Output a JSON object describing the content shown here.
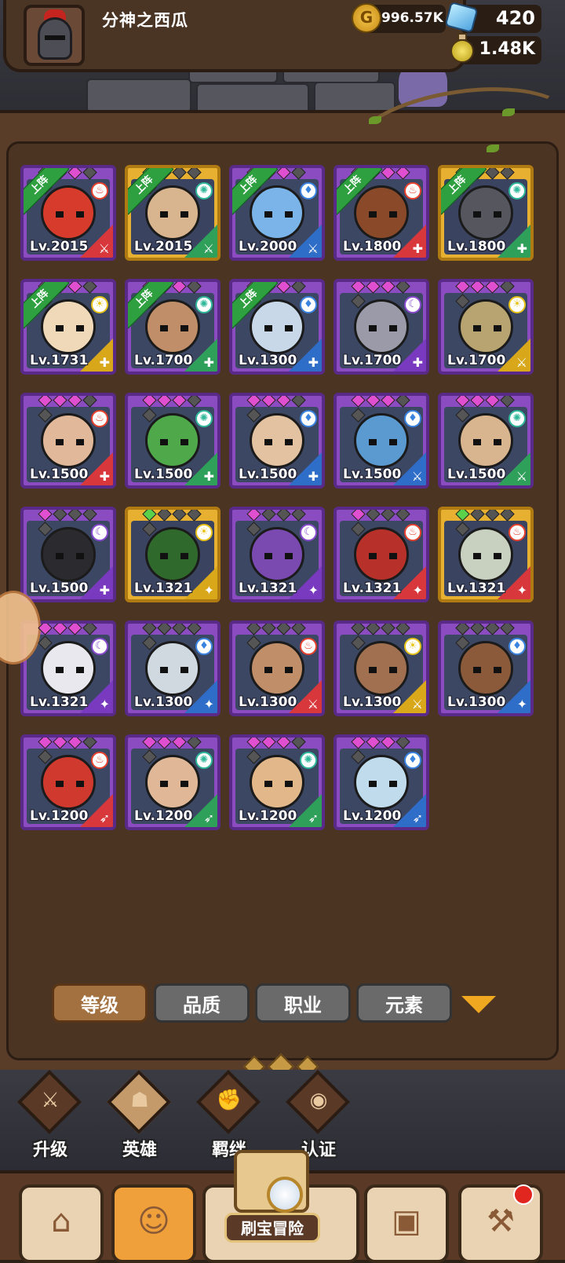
{
  "player": {
    "name": "分神之西瓜"
  },
  "resources": {
    "gold": "996.57K",
    "gems": "420",
    "potion": "1.48K"
  },
  "heroes": [
    {
      "level": "Lv.2015",
      "frame": "purple",
      "deployed": true,
      "element": "fire",
      "element_color": "#e8422e",
      "class_color": "#d8383c",
      "class_glyph": "⚔",
      "skin": "#d63b2c",
      "stars_on": 3,
      "star_color": "g"
    },
    {
      "level": "Lv.2015",
      "frame": "gold",
      "deployed": true,
      "element": "wind",
      "element_color": "#2fb89a",
      "class_color": "#2fa05a",
      "class_glyph": "⚔",
      "skin": "#d9b58f",
      "stars_on": 1,
      "star_color": "g"
    },
    {
      "level": "Lv.2000",
      "frame": "purple",
      "deployed": true,
      "element": "water",
      "element_color": "#3a84e0",
      "class_color": "#2f6ec8",
      "class_glyph": "⚔",
      "skin": "#7ab4e8",
      "stars_on": 3,
      "star_color": "on"
    },
    {
      "level": "Lv.1800",
      "frame": "purple",
      "deployed": true,
      "element": "fire",
      "element_color": "#e8422e",
      "class_color": "#d8383c",
      "class_glyph": "✚",
      "skin": "#8a4a2a",
      "stars_on": 5,
      "star_color": "on"
    },
    {
      "level": "Lv.1800",
      "frame": "gold",
      "deployed": true,
      "element": "wind",
      "element_color": "#2fb89a",
      "class_color": "#2fa05a",
      "class_glyph": "✚",
      "skin": "#55565e",
      "stars_on": 1,
      "star_color": "g"
    },
    {
      "level": "Lv.1731",
      "frame": "purple",
      "deployed": true,
      "element": "light",
      "element_color": "#e8c41a",
      "class_color": "#d8a81a",
      "class_glyph": "✚",
      "skin": "#f0d9b8",
      "stars_on": 3,
      "star_color": "on"
    },
    {
      "level": "Lv.1700",
      "frame": "purple",
      "deployed": true,
      "element": "wind",
      "element_color": "#2fb89a",
      "class_color": "#2fa05a",
      "class_glyph": "✚",
      "skin": "#c08e68",
      "stars_on": 3,
      "star_color": "on"
    },
    {
      "level": "Lv.1300",
      "frame": "purple",
      "deployed": true,
      "element": "water",
      "element_color": "#3a84e0",
      "class_color": "#2f6ec8",
      "class_glyph": "✚",
      "skin": "#c8d8e8",
      "stars_on": 3,
      "star_color": "on"
    },
    {
      "level": "Lv.1700",
      "frame": "purple",
      "deployed": false,
      "element": "dark",
      "element_color": "#8a4ad0",
      "class_color": "#7a3ac0",
      "class_glyph": "✚",
      "skin": "#9a9aa8",
      "stars_on": 3,
      "star_color": "on"
    },
    {
      "level": "Lv.1700",
      "frame": "purple",
      "deployed": false,
      "element": "light",
      "element_color": "#e8c41a",
      "class_color": "#d8a81a",
      "class_glyph": "⚔",
      "skin": "#b8a470",
      "stars_on": 3,
      "star_color": "on"
    },
    {
      "level": "Lv.1500",
      "frame": "purple",
      "deployed": false,
      "element": "fire",
      "element_color": "#e8422e",
      "class_color": "#d8383c",
      "class_glyph": "✚",
      "skin": "#e2b89a",
      "stars_on": 3,
      "star_color": "on"
    },
    {
      "level": "Lv.1500",
      "frame": "purple",
      "deployed": false,
      "element": "wind",
      "element_color": "#2fb89a",
      "class_color": "#2fa05a",
      "class_glyph": "✚",
      "skin": "#4fa84a",
      "stars_on": 3,
      "star_color": "on"
    },
    {
      "level": "Lv.1500",
      "frame": "purple",
      "deployed": false,
      "element": "water",
      "element_color": "#3a84e0",
      "class_color": "#2f6ec8",
      "class_glyph": "✚",
      "skin": "#e2c2a0",
      "stars_on": 3,
      "star_color": "on"
    },
    {
      "level": "Lv.1500",
      "frame": "purple",
      "deployed": false,
      "element": "water",
      "element_color": "#3a84e0",
      "class_color": "#2f6ec8",
      "class_glyph": "⚔",
      "skin": "#5a9ad0",
      "stars_on": 3,
      "star_color": "on"
    },
    {
      "level": "Lv.1500",
      "frame": "purple",
      "deployed": false,
      "element": "wind",
      "element_color": "#2fb89a",
      "class_color": "#2fa05a",
      "class_glyph": "⚔",
      "skin": "#d9b58f",
      "stars_on": 3,
      "star_color": "on"
    },
    {
      "level": "Lv.1500",
      "frame": "purple",
      "deployed": false,
      "element": "dark",
      "element_color": "#8a4ad0",
      "class_color": "#7a3ac0",
      "class_glyph": "✚",
      "skin": "#2b2b2f",
      "stars_on": 1,
      "star_color": "on"
    },
    {
      "level": "Lv.1321",
      "frame": "gold",
      "deployed": false,
      "element": "light",
      "element_color": "#e8c41a",
      "class_color": "#d8a81a",
      "class_glyph": "✦",
      "skin": "#2f6a2c",
      "stars_on": 1,
      "star_color": "g"
    },
    {
      "level": "Lv.1321",
      "frame": "purple",
      "deployed": false,
      "element": "dark",
      "element_color": "#8a4ad0",
      "class_color": "#7a3ac0",
      "class_glyph": "✦",
      "skin": "#7a4ab0",
      "stars_on": 1,
      "star_color": "on"
    },
    {
      "level": "Lv.1321",
      "frame": "purple",
      "deployed": false,
      "element": "fire",
      "element_color": "#e8422e",
      "class_color": "#d8383c",
      "class_glyph": "✦",
      "skin": "#b8302a",
      "stars_on": 1,
      "star_color": "on"
    },
    {
      "level": "Lv.1321",
      "frame": "gold",
      "deployed": false,
      "element": "fire",
      "element_color": "#e8422e",
      "class_color": "#d8383c",
      "class_glyph": "✦",
      "skin": "#c8d0c0",
      "stars_on": 1,
      "star_color": "g"
    },
    {
      "level": "Lv.1321",
      "frame": "purple",
      "deployed": false,
      "element": "dark",
      "element_color": "#8a4ad0",
      "class_color": "#7a3ac0",
      "class_glyph": "✦",
      "skin": "#e8e8ee",
      "stars_on": 3,
      "star_color": "on"
    },
    {
      "level": "Lv.1300",
      "frame": "purple",
      "deployed": false,
      "element": "water",
      "element_color": "#3a84e0",
      "class_color": "#2f6ec8",
      "class_glyph": "✦",
      "skin": "#d0d8e0",
      "stars_on": 0,
      "star_color": "on"
    },
    {
      "level": "Lv.1300",
      "frame": "purple",
      "deployed": false,
      "element": "fire",
      "element_color": "#e8422e",
      "class_color": "#d8383c",
      "class_glyph": "⚔",
      "skin": "#c08e68",
      "stars_on": 0,
      "star_color": "on"
    },
    {
      "level": "Lv.1300",
      "frame": "purple",
      "deployed": false,
      "element": "light",
      "element_color": "#e8c41a",
      "class_color": "#d8a81a",
      "class_glyph": "⚔",
      "skin": "#a07050",
      "stars_on": 0,
      "star_color": "on"
    },
    {
      "level": "Lv.1300",
      "frame": "purple",
      "deployed": false,
      "element": "water",
      "element_color": "#3a84e0",
      "class_color": "#2f6ec8",
      "class_glyph": "✦",
      "skin": "#8a5a3a",
      "stars_on": 0,
      "star_color": "on"
    },
    {
      "level": "Lv.1200",
      "frame": "purple",
      "deployed": false,
      "element": "fire",
      "element_color": "#e8422e",
      "class_color": "#d8383c",
      "class_glyph": "➶",
      "skin": "#d03a2e",
      "stars_on": 3,
      "star_color": "on"
    },
    {
      "level": "Lv.1200",
      "frame": "purple",
      "deployed": false,
      "element": "wind",
      "element_color": "#2fb89a",
      "class_color": "#2fa05a",
      "class_glyph": "➶",
      "skin": "#e0b898",
      "stars_on": 3,
      "star_color": "on"
    },
    {
      "level": "Lv.1200",
      "frame": "purple",
      "deployed": false,
      "element": "wind",
      "element_color": "#2fb89a",
      "class_color": "#2fa05a",
      "class_glyph": "➶",
      "skin": "#e2b88a",
      "stars_on": 3,
      "star_color": "on"
    },
    {
      "level": "Lv.1200",
      "frame": "purple",
      "deployed": false,
      "element": "water",
      "element_color": "#3a84e0",
      "class_color": "#2f6ec8",
      "class_glyph": "➶",
      "skin": "#c0dcec",
      "stars_on": 3,
      "star_color": "on"
    }
  ],
  "deployed_tag": "上阵",
  "sort_tabs": [
    {
      "label": "等级",
      "active": true
    },
    {
      "label": "品质",
      "active": false
    },
    {
      "label": "职业",
      "active": false
    },
    {
      "label": "元素",
      "active": false
    }
  ],
  "sub_nav": [
    {
      "label": "升级",
      "glyph": "⚔",
      "icon": "sword-icon",
      "active": false
    },
    {
      "label": "英雄",
      "glyph": "☗",
      "icon": "hero-icon",
      "active": true
    },
    {
      "label": "羁绊",
      "glyph": "✊",
      "icon": "fist-icon",
      "active": false
    },
    {
      "label": "认证",
      "glyph": "◉",
      "icon": "eye-icon",
      "active": false
    }
  ],
  "bottom_nav": {
    "adventure_label": "刷宝冒险",
    "tiles": [
      {
        "icon": "shop-icon",
        "glyph": "⌂",
        "active": false,
        "badge": false
      },
      {
        "icon": "hero-portrait-icon",
        "glyph": "☺",
        "active": true,
        "badge": false
      },
      {
        "icon": "backpack-icon",
        "glyph": "▣",
        "active": false,
        "badge": false
      },
      {
        "icon": "forge-hammer-icon",
        "glyph": "⚒",
        "active": false,
        "badge": true
      }
    ]
  }
}
